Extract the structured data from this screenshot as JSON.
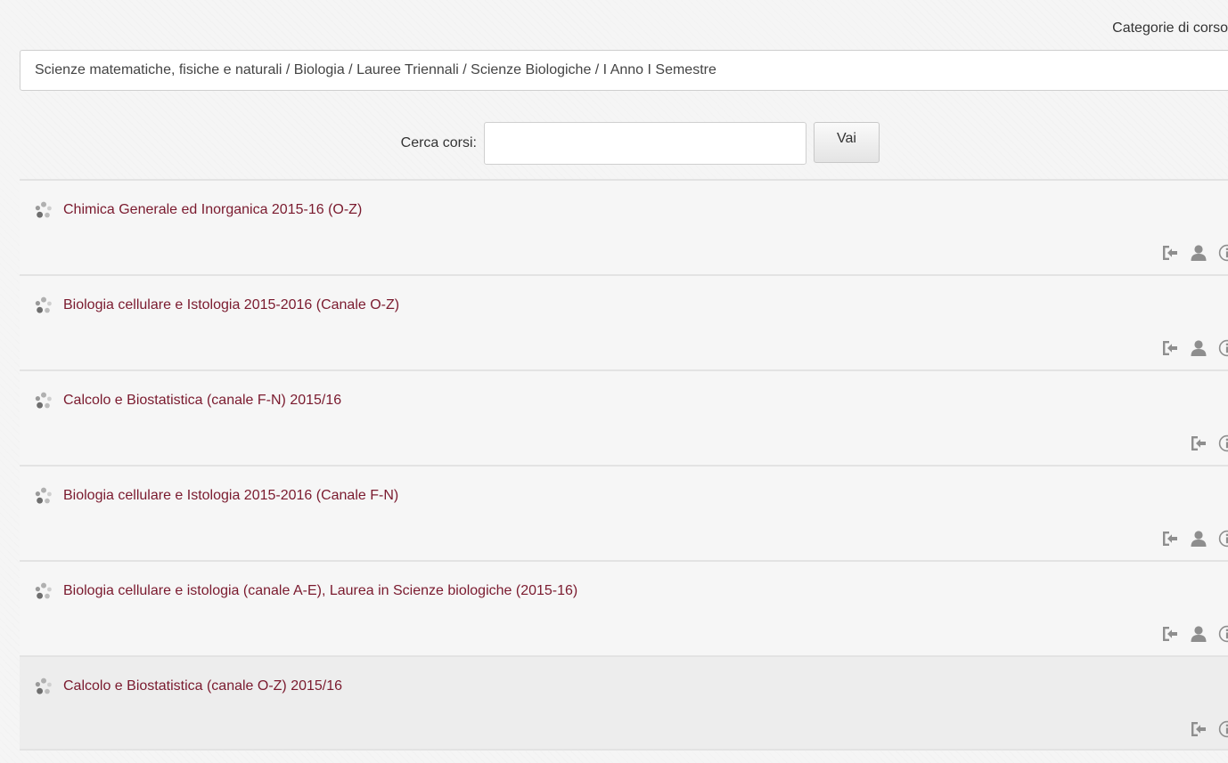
{
  "header": {
    "category_label": "Categorie di corso",
    "category_selected": "Scienze matematiche, fisiche e naturali / Biologia / Lauree Triennali / Scienze Biologiche / I Anno I Semestre"
  },
  "search": {
    "label": "Cerca corsi:",
    "value": "",
    "placeholder": "",
    "button_label": "Vai"
  },
  "courses": [
    {
      "title": "Chimica Generale ed Inorganica 2015-16 (O-Z)",
      "actions": [
        "enrol-icon",
        "user-icon",
        "info-icon"
      ]
    },
    {
      "title": "Biologia cellulare e Istologia 2015-2016 (Canale O-Z)",
      "actions": [
        "enrol-icon",
        "user-icon",
        "info-icon"
      ]
    },
    {
      "title": "Calcolo e Biostatistica (canale F-N) 2015/16",
      "actions": [
        "enrol-icon",
        "info-icon"
      ]
    },
    {
      "title": "Biologia cellulare e Istologia 2015-2016 (Canale F-N)",
      "actions": [
        "enrol-icon",
        "user-icon",
        "info-icon"
      ]
    },
    {
      "title": "Biologia cellulare e istologia (canale A-E), Laurea in Scienze biologiche (2015-16)",
      "actions": [
        "enrol-icon",
        "user-icon",
        "info-icon"
      ]
    },
    {
      "title": "Calcolo e Biostatistica (canale O-Z) 2015/16",
      "actions": [
        "enrol-icon",
        "info-icon"
      ]
    }
  ],
  "colors": {
    "link": "#7a1a2e",
    "icon": "#8e8e8e"
  }
}
